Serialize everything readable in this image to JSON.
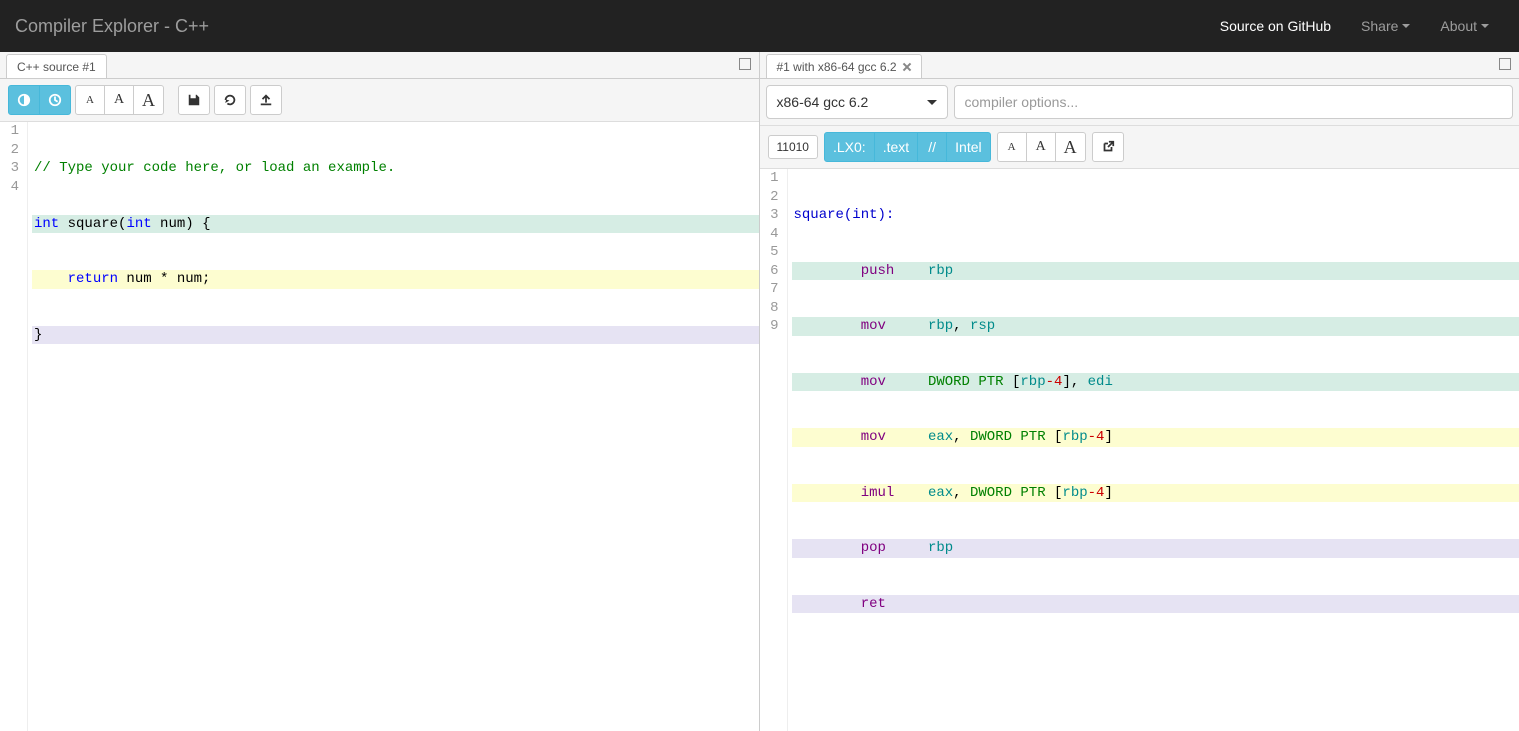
{
  "navbar": {
    "title": "Compiler Explorer - C++",
    "github": "Source on GitHub",
    "share": "Share",
    "about": "About"
  },
  "source_pane": {
    "tab_label": "C++ source #1",
    "lines": [
      "1",
      "2",
      "3",
      "4"
    ],
    "code": {
      "l1_comment": "// Type your code here, or load an example.",
      "l2_int": "int",
      "l2_func": "square(",
      "l2_int2": "int",
      "l2_param": " num) {",
      "l3_return": "return",
      "l3_expr": " num * num;",
      "l4_brace": "}"
    }
  },
  "asm_pane": {
    "tab_label": "#1 with x86-64 gcc 6.2",
    "compiler_selected": "x86-64 gcc 6.2",
    "options_placeholder": "compiler options...",
    "toolbar": {
      "binary": "11010",
      "lx0": ".LX0:",
      "text": ".text",
      "comments": "//",
      "intel": "Intel"
    },
    "lines": [
      "1",
      "2",
      "3",
      "4",
      "5",
      "6",
      "7",
      "8",
      "9"
    ],
    "code": {
      "l1_label": "square(int):",
      "push": "push",
      "mov": "mov",
      "imul": "imul",
      "pop": "pop",
      "ret": "ret",
      "rbp": "rbp",
      "rsp": "rsp",
      "eax": "eax",
      "edi": "edi",
      "dword": "DWORD",
      "ptr": "PTR",
      "l_br": "[",
      "r_br": "]",
      "minus4": "-4",
      "comma": ", "
    }
  }
}
